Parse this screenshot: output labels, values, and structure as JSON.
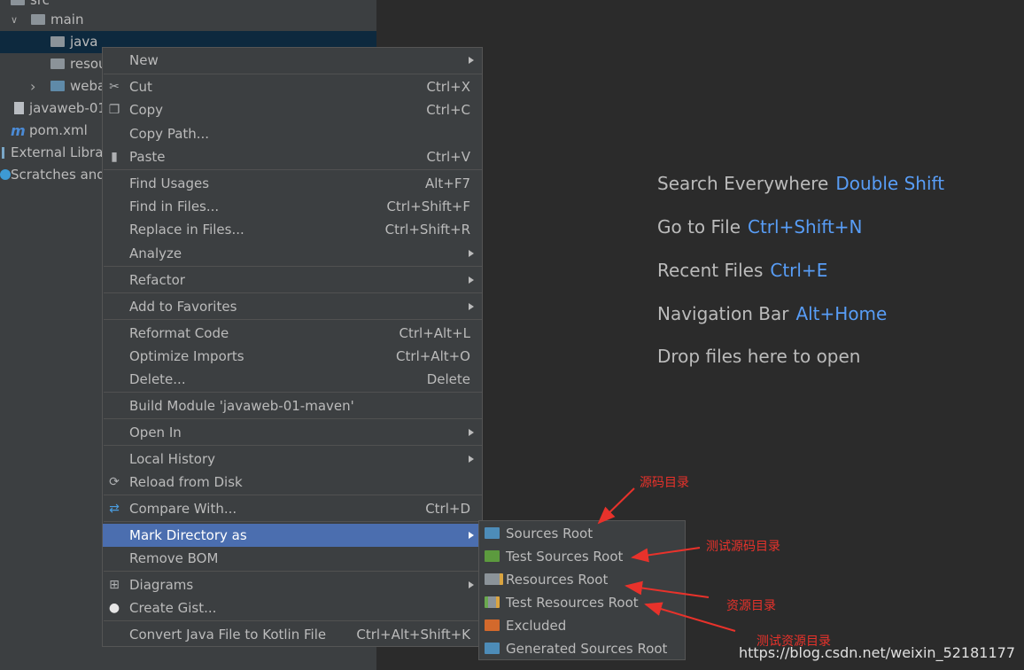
{
  "project_tree": [
    {
      "label": "src",
      "arrow": "",
      "icon": "folder-icon"
    },
    {
      "label": "main",
      "arrow": "∨",
      "icon": "folder-icon"
    },
    {
      "label": "java",
      "arrow": "",
      "icon": "folder-icon",
      "selected": true
    },
    {
      "label": "resou",
      "arrow": "",
      "icon": "folder-icon"
    },
    {
      "label": "weba",
      "arrow": "›",
      "icon": "web-folder-icon"
    },
    {
      "label": "javaweb-01",
      "arrow": "",
      "icon": "file-icon"
    },
    {
      "label": "pom.xml",
      "arrow": "",
      "icon": "maven-icon",
      "icon_text": "m"
    },
    {
      "label": "External Librar",
      "arrow": "",
      "icon": "library-icon"
    },
    {
      "label": "Scratches and",
      "arrow": "",
      "icon": "scratches-icon"
    }
  ],
  "editor_hints": [
    {
      "text": "Search Everywhere",
      "key": "Double Shift"
    },
    {
      "text": "Go to File",
      "key": "Ctrl+Shift+N"
    },
    {
      "text": "Recent Files",
      "key": "Ctrl+E"
    },
    {
      "text": "Navigation Bar",
      "key": "Alt+Home"
    },
    {
      "text": "Drop files here to open",
      "key": ""
    }
  ],
  "context_menu": [
    {
      "label": "New",
      "shortcut": "",
      "submenu": true,
      "icon": ""
    },
    {
      "label": "Cut",
      "shortcut": "Ctrl+X",
      "icon": "scissors-icon",
      "glyph": "✂"
    },
    {
      "label": "Copy",
      "shortcut": "Ctrl+C",
      "icon": "copy-icon",
      "glyph": "❐"
    },
    {
      "label": "Copy Path...",
      "shortcut": ""
    },
    {
      "label": "Paste",
      "shortcut": "Ctrl+V",
      "icon": "clipboard-icon",
      "glyph": "▮"
    },
    {
      "label": "Find Usages",
      "shortcut": "Alt+F7"
    },
    {
      "label": "Find in Files...",
      "shortcut": "Ctrl+Shift+F"
    },
    {
      "label": "Replace in Files...",
      "shortcut": "Ctrl+Shift+R"
    },
    {
      "label": "Analyze",
      "shortcut": "",
      "submenu": true
    },
    {
      "label": "Refactor",
      "shortcut": "",
      "submenu": true
    },
    {
      "label": "Add to Favorites",
      "shortcut": "",
      "submenu": true
    },
    {
      "label": "Reformat Code",
      "shortcut": "Ctrl+Alt+L"
    },
    {
      "label": "Optimize Imports",
      "shortcut": "Ctrl+Alt+O"
    },
    {
      "label": "Delete...",
      "shortcut": "Delete"
    },
    {
      "label": "Build Module 'javaweb-01-maven'",
      "shortcut": ""
    },
    {
      "label": "Open In",
      "shortcut": "",
      "submenu": true
    },
    {
      "label": "Local History",
      "shortcut": "",
      "submenu": true
    },
    {
      "label": "Reload from Disk",
      "shortcut": "",
      "icon": "reload-icon",
      "glyph": "⟳"
    },
    {
      "label": "Compare With...",
      "shortcut": "Ctrl+D",
      "icon": "compare-icon",
      "glyph": "⇄"
    },
    {
      "label": "Mark Directory as",
      "shortcut": "",
      "submenu": true,
      "active": true
    },
    {
      "label": "Remove BOM",
      "shortcut": ""
    },
    {
      "label": "Diagrams",
      "shortcut": "",
      "submenu": true,
      "icon": "diagram-icon",
      "glyph": "⊞"
    },
    {
      "label": "Create Gist...",
      "shortcut": "",
      "icon": "github-icon",
      "glyph": "●"
    },
    {
      "label": "Convert Java File to Kotlin File",
      "shortcut": "Ctrl+Alt+Shift+K"
    }
  ],
  "mark_directory_submenu": [
    {
      "label": "Sources Root",
      "icon": "sources-root-icon",
      "color": "#4d8cb8"
    },
    {
      "label": "Test Sources Root",
      "icon": "test-sources-root-icon",
      "color": "#5c9a3e"
    },
    {
      "label": "Resources Root",
      "icon": "resources-root-icon",
      "color": "#8b9399"
    },
    {
      "label": "Test Resources Root",
      "icon": "test-resources-root-icon",
      "color": "#8b9399"
    },
    {
      "label": "Excluded",
      "icon": "excluded-icon",
      "color": "#d3692c"
    },
    {
      "label": "Generated Sources Root",
      "icon": "generated-sources-root-icon",
      "color": "#4d8cb8"
    }
  ],
  "annotations": {
    "source_dir": "源码目录",
    "test_source_dir": "测试源码目录",
    "resource_dir": "资源目录",
    "test_resource_dir": "测试资源目录"
  },
  "watermark": "https://blog.csdn.net/weixin_52181177"
}
